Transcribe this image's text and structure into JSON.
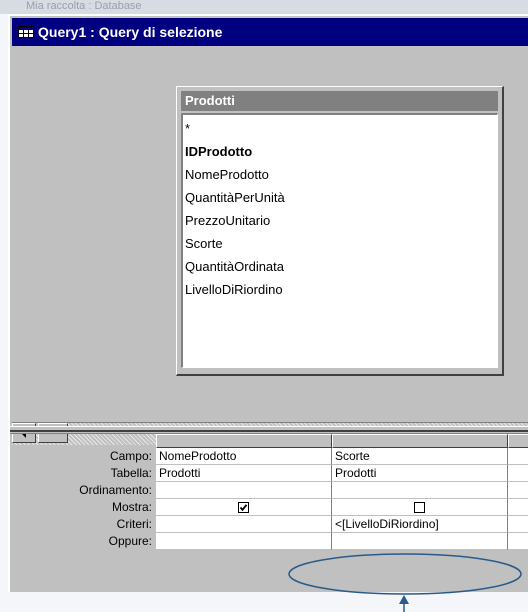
{
  "background_window_title": "Mia raccolta : Database",
  "window": {
    "title": "Query1 : Query di selezione"
  },
  "table": {
    "name": "Prodotti",
    "fields": [
      "*",
      "IDProdotto",
      "NomeProdotto",
      "QuantitàPerUnità",
      "PrezzoUnitario",
      "Scorte",
      "QuantitàOrdinata",
      "LivelloDiRiordino"
    ],
    "primary_key": "IDProdotto"
  },
  "grid": {
    "row_labels": [
      "Campo:",
      "Tabella:",
      "Ordinamento:",
      "Mostra:",
      "Criteri:",
      "Oppure:"
    ],
    "columns": [
      {
        "campo": "NomeProdotto",
        "tabella": "Prodotti",
        "ordinamento": "",
        "mostra": true,
        "criteri": "",
        "oppure": ""
      },
      {
        "campo": "Scorte",
        "tabella": "Prodotti",
        "ordinamento": "",
        "mostra": false,
        "criteri": "<[LivelloDiRiordino]",
        "oppure": ""
      },
      {
        "campo": "",
        "tabella": "",
        "ordinamento": "",
        "mostra": null,
        "criteri": "",
        "oppure": ""
      }
    ]
  },
  "annotation": {
    "highlight_color": "#2a5a8a"
  }
}
